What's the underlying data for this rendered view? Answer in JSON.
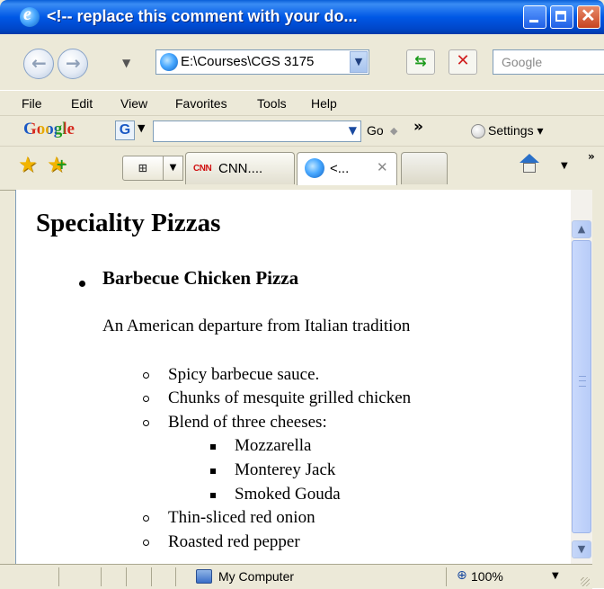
{
  "window": {
    "title": "<!-- replace this comment with your do...",
    "minimize": "minimize",
    "maximize": "maximize",
    "close": "✕"
  },
  "address": {
    "url": "E:\\Courses\\CGS 3175",
    "search_placeholder": "Google",
    "back_glyph": "←",
    "forward_glyph": "→"
  },
  "menu": {
    "items": [
      "File",
      "Edit",
      "View",
      "Favorites",
      "Tools",
      "Help"
    ]
  },
  "google_toolbar": {
    "logo": "Google",
    "g_icon": "G",
    "go": "Go",
    "more": "»",
    "settings": "Settings"
  },
  "tabs": [
    {
      "label": "CNN....",
      "icon": "cnn-icon",
      "logo": "CNN",
      "active": false
    },
    {
      "label": "<...",
      "icon": "ie-icon",
      "active": true
    }
  ],
  "document": {
    "heading": "Speciality Pizzas",
    "pizza": {
      "name": "Barbecue Chicken Pizza",
      "description": "An American departure from Italian tradition",
      "ingredients": [
        "Spicy barbecue sauce.",
        "Chunks of mesquite grilled chicken",
        "Blend of three cheeses:",
        "Thin-sliced red onion",
        "Roasted red pepper"
      ],
      "cheeses": [
        "Mozzarella",
        "Monterey Jack",
        "Smoked Gouda"
      ]
    }
  },
  "status": {
    "zone": "My Computer",
    "zoom": "100%"
  },
  "colors": {
    "titlebar": "#0058e6",
    "chrome": "#ece9d8",
    "scroll_thumb": "#b8ccf8"
  }
}
